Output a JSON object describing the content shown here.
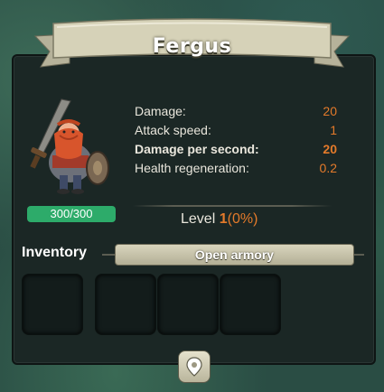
{
  "hero": {
    "name": "Fergus",
    "health": "300/300",
    "portrait_icon": "red-bearded-dwarf-warrior-with-sword-and-shield"
  },
  "stats": [
    {
      "label": "Damage:",
      "value": "20",
      "bold": false
    },
    {
      "label": "Attack speed:",
      "value": "1",
      "bold": false
    },
    {
      "label": "Damage per second:",
      "value": "20",
      "bold": true
    },
    {
      "label": "Health regeneration:",
      "value": "0.2",
      "bold": false
    }
  ],
  "level": {
    "label": "Level",
    "number": "1",
    "progress": "(0%)"
  },
  "inventory": {
    "label": "Inventory",
    "button_label": "Open armory",
    "slot_count": 4
  },
  "footer": {
    "icon": "map-pin-icon"
  },
  "colors": {
    "accent": "#e47a2a",
    "health_badge": "#2dab6a",
    "panel": "#1b2725",
    "banner": "#d6d2b8"
  }
}
